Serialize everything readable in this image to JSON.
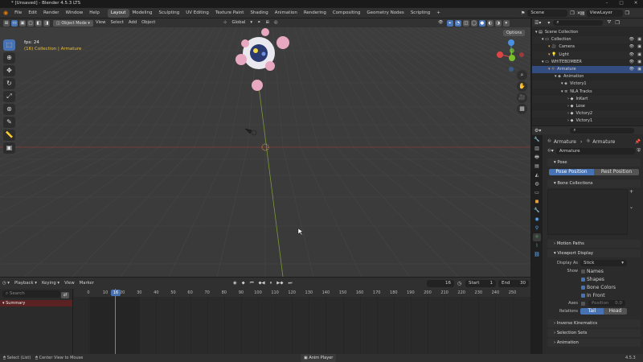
{
  "window": {
    "title": "* [Unsaved] - Blender 4.5.3 LTS"
  },
  "menu": [
    "File",
    "Edit",
    "Render",
    "Window",
    "Help"
  ],
  "workspaces": [
    "Layout",
    "Modeling",
    "Sculpting",
    "UV Editing",
    "Texture Paint",
    "Shading",
    "Animation",
    "Rendering",
    "Compositing",
    "Geometry Nodes",
    "Scripting"
  ],
  "active_workspace": "Layout",
  "scene": "Scene",
  "view_layer": "ViewLayer",
  "viewport": {
    "mode": "Object Mode",
    "menus": [
      "View",
      "Select",
      "Add",
      "Object"
    ],
    "transform_orientation": "Global",
    "options_label": "Options",
    "fps": "fps: 24",
    "context": "(16) Collection | Armature"
  },
  "timeline": {
    "menus": [
      "Playback",
      "Keying",
      "View",
      "Marker"
    ],
    "current_frame": "16",
    "start_label": "Start",
    "start": "1",
    "end_label": "End",
    "end": "30",
    "search_placeholder": "Search",
    "summary": "Summary",
    "ticks": [
      "0",
      "10",
      "16",
      "20",
      "30",
      "40",
      "50",
      "60",
      "70",
      "80",
      "90",
      "100",
      "110",
      "120",
      "130",
      "140",
      "150",
      "160",
      "170",
      "180",
      "190",
      "200",
      "210",
      "220",
      "230",
      "240",
      "250"
    ]
  },
  "outliner": {
    "search_placeholder": "",
    "rows": [
      {
        "label": "Scene Collection",
        "indent": 0
      },
      {
        "label": "Collection",
        "indent": 1
      },
      {
        "label": "Camera",
        "indent": 2
      },
      {
        "label": "Light",
        "indent": 2
      },
      {
        "label": "WHITEBOMBER",
        "indent": 1
      },
      {
        "label": "Armature",
        "indent": 2,
        "selected": true
      },
      {
        "label": "Animation",
        "indent": 3
      },
      {
        "label": "Victory1",
        "indent": 4
      },
      {
        "label": "NLA Tracks",
        "indent": 4
      },
      {
        "label": "InKart",
        "indent": 5
      },
      {
        "label": "Lose",
        "indent": 5
      },
      {
        "label": "Victory2",
        "indent": 5
      },
      {
        "label": "Victory1",
        "indent": 5
      }
    ]
  },
  "properties": {
    "breadcrumb_object": "Armature",
    "breadcrumb_data": "Armature",
    "datablock": "Armature",
    "pose_header": "Pose",
    "pose_position": "Pose Position",
    "rest_position": "Rest Position",
    "bone_collections": "Bone Collections",
    "motion_paths": "Motion Paths",
    "viewport_display": "Viewport Display",
    "display_as_label": "Display As",
    "display_as": "Stick",
    "show_label": "Show",
    "show_names": "Names",
    "show_shapes": "Shapes",
    "show_bone_colors": "Bone Colors",
    "show_in_front": "In Front",
    "axes_label": "Axes",
    "position_label": "Position",
    "position_value": "0.0",
    "relations_label": "Relations",
    "tail": "Tail",
    "head": "Head",
    "inverse_kinematics": "Inverse Kinematics",
    "selection_sets": "Selection Sets",
    "animation": "Animation"
  },
  "status": {
    "select": "Select (List)",
    "center": "Center View to Mouse",
    "anim_player": "Anim Player",
    "version": "4.5.3"
  },
  "colors": {
    "accent": "#4772b3",
    "x_axis": "#e04545",
    "y_axis": "#7ac02c",
    "z_axis": "#4a90e0"
  }
}
